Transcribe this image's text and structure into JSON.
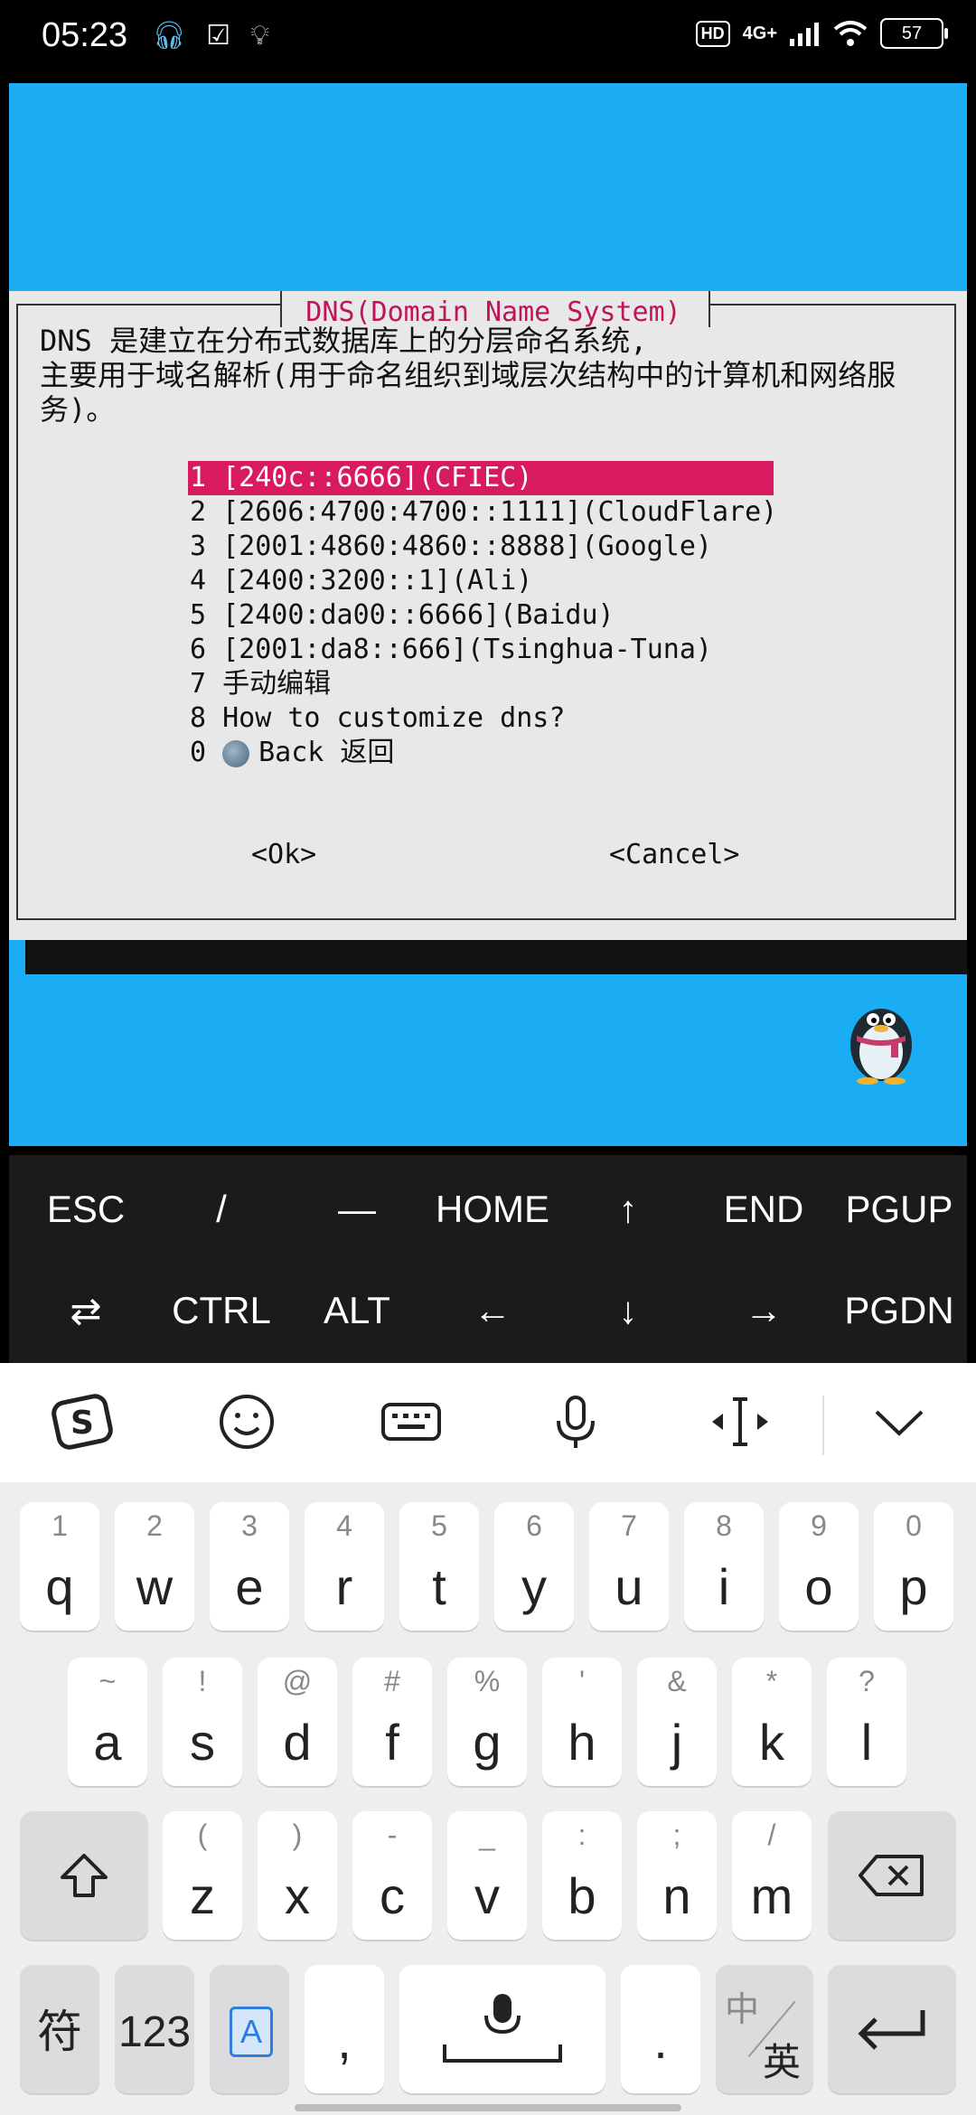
{
  "status": {
    "time": "05:23",
    "hd": "HD",
    "network": "4G+",
    "battery": "57"
  },
  "dialog": {
    "title": "DNS(Domain Name System)",
    "description": "DNS 是建立在分布式数据库上的分层命名系统,\n主要用于域名解析(用于命名组织到域层次结构中的计算机和网络服务)。",
    "items": [
      {
        "num": "1",
        "label": "[240c::6666](CFIEC)"
      },
      {
        "num": "2",
        "label": "[2606:4700:4700::1111](CloudFlare)"
      },
      {
        "num": "3",
        "label": "[2001:4860:4860::8888](Google)"
      },
      {
        "num": "4",
        "label": "[2400:3200::1](Ali)"
      },
      {
        "num": "5",
        "label": "[2400:da00::6666](Baidu)"
      },
      {
        "num": "6",
        "label": "[2001:da8::666](Tsinghua-Tuna)"
      },
      {
        "num": "7",
        "label": "手动编辑"
      },
      {
        "num": "8",
        "label": "How to customize dns?"
      },
      {
        "num": "0",
        "label": "Back 返回"
      }
    ],
    "ok": "<Ok>",
    "cancel": "<Cancel>"
  },
  "extra_keys": {
    "row1": [
      "ESC",
      "/",
      "—",
      "HOME",
      "↑",
      "END",
      "PGUP"
    ],
    "row2": [
      "⇄",
      "CTRL",
      "ALT",
      "←",
      "↓",
      "→",
      "PGDN"
    ]
  },
  "keyboard": {
    "row1": [
      [
        "q",
        "1"
      ],
      [
        "w",
        "2"
      ],
      [
        "e",
        "3"
      ],
      [
        "r",
        "4"
      ],
      [
        "t",
        "5"
      ],
      [
        "y",
        "6"
      ],
      [
        "u",
        "7"
      ],
      [
        "i",
        "8"
      ],
      [
        "o",
        "9"
      ],
      [
        "p",
        "0"
      ]
    ],
    "row2": [
      [
        "a",
        "~"
      ],
      [
        "s",
        "!"
      ],
      [
        "d",
        "@"
      ],
      [
        "f",
        "#"
      ],
      [
        "g",
        "%"
      ],
      [
        "h",
        "'"
      ],
      [
        "j",
        "&"
      ],
      [
        "k",
        "*"
      ],
      [
        "l",
        "?"
      ]
    ],
    "row3": [
      [
        "z",
        "("
      ],
      [
        "x",
        ")"
      ],
      [
        "c",
        "-"
      ],
      [
        "v",
        "_"
      ],
      [
        "b",
        ":"
      ],
      [
        "n",
        ";"
      ],
      [
        "m",
        "/"
      ]
    ],
    "bottom": {
      "symbols": "符",
      "numbers": "123",
      "lang_icon": "A",
      "comma": ",",
      "period": ".",
      "zh": "中",
      "en": "英"
    }
  }
}
